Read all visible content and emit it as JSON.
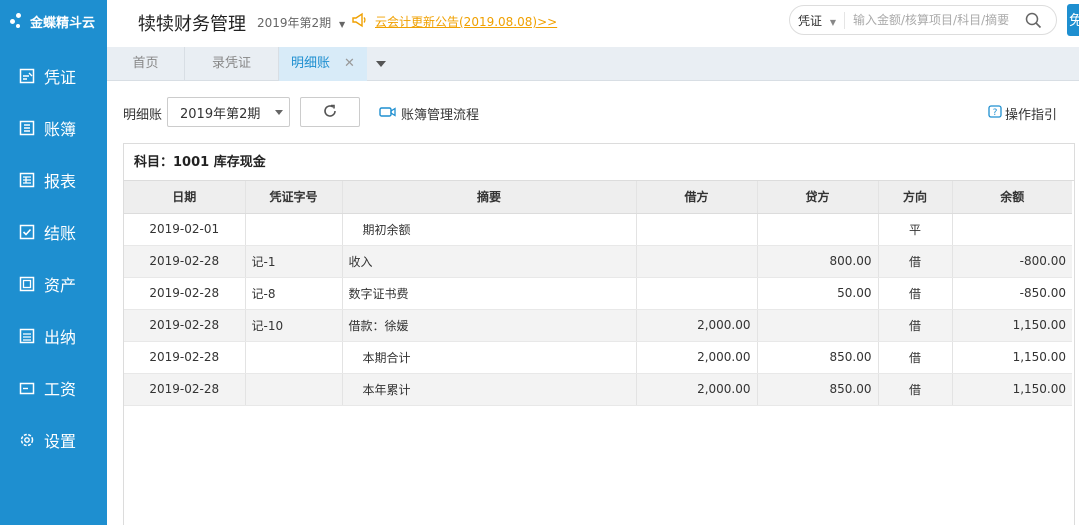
{
  "sidebar": {
    "logo": "金蝶精斗云",
    "items": [
      {
        "label": "凭证",
        "icon": "voucher-icon"
      },
      {
        "label": "账簿",
        "icon": "ledger-icon"
      },
      {
        "label": "报表",
        "icon": "report-icon"
      },
      {
        "label": "结账",
        "icon": "checkout-icon"
      },
      {
        "label": "资产",
        "icon": "asset-icon"
      },
      {
        "label": "出纳",
        "icon": "cashier-icon"
      },
      {
        "label": "工资",
        "icon": "salary-icon"
      },
      {
        "label": "设置",
        "icon": "gear-icon"
      }
    ]
  },
  "header": {
    "title": "犊犊财务管理",
    "period": "2019年第2期",
    "notice": "云会计更新公告(2019.08.08)>>",
    "search_type": "凭证",
    "search_placeholder": "输入金额/核算项目/科目/摘要",
    "corner_label": "免"
  },
  "tabs": [
    {
      "label": "首页"
    },
    {
      "label": "录凭证"
    },
    {
      "label": "明细账",
      "active": true
    }
  ],
  "toolbar": {
    "label": "明细账",
    "period": "2019年第2期",
    "flow_link": "账簿管理流程",
    "guide_link": "操作指引"
  },
  "ledger": {
    "subject": "科目：1001 库存现金",
    "columns": [
      "日期",
      "凭证字号",
      "摘要",
      "借方",
      "贷方",
      "方向",
      "余额"
    ],
    "rows": [
      {
        "date": "2019-02-01",
        "voucher": "",
        "summary": "期初余额",
        "debit": "",
        "credit": "",
        "direction": "平",
        "balance": "",
        "indent": true
      },
      {
        "date": "2019-02-28",
        "voucher": "记-1",
        "summary": "收入",
        "debit": "",
        "credit": "800.00",
        "direction": "借",
        "balance": "-800.00",
        "indent": false
      },
      {
        "date": "2019-02-28",
        "voucher": "记-8",
        "summary": "数字证书费",
        "debit": "",
        "credit": "50.00",
        "direction": "借",
        "balance": "-850.00",
        "indent": false
      },
      {
        "date": "2019-02-28",
        "voucher": "记-10",
        "summary": "借款：徐媛",
        "debit": "2,000.00",
        "credit": "",
        "direction": "借",
        "balance": "1,150.00",
        "indent": false
      },
      {
        "date": "2019-02-28",
        "voucher": "",
        "summary": "本期合计",
        "debit": "2,000.00",
        "credit": "850.00",
        "direction": "借",
        "balance": "1,150.00",
        "indent": true
      },
      {
        "date": "2019-02-28",
        "voucher": "",
        "summary": "本年累计",
        "debit": "2,000.00",
        "credit": "850.00",
        "direction": "借",
        "balance": "1,150.00",
        "indent": true
      }
    ]
  },
  "colors": {
    "sidebar": "#1e8fd0",
    "notice": "#f0a000",
    "active_tab": "#1e8fd0"
  }
}
